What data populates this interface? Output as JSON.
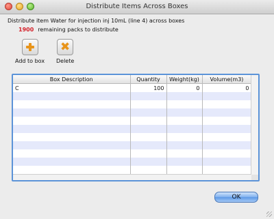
{
  "window": {
    "title": "Distribute Items Across Boxes"
  },
  "info": {
    "description": "Distribute item Water for injection inj 10mL (line 4) across boxes",
    "remaining_count": "1900",
    "remaining_text": "remaining packs to distribute"
  },
  "toolbar": {
    "add_label": "Add to box",
    "delete_label": "Delete",
    "add_icon": "add-box-icon",
    "delete_icon": "delete-icon"
  },
  "table": {
    "columns": [
      "Box Description",
      "Quantity",
      "Weight(kg)",
      "Volume(m3)"
    ],
    "rows": [
      [
        "C",
        "100",
        "0",
        "0"
      ],
      [
        "",
        "",
        "",
        ""
      ],
      [
        "",
        "",
        "",
        ""
      ],
      [
        "",
        "",
        "",
        ""
      ],
      [
        "",
        "",
        "",
        ""
      ],
      [
        "",
        "",
        "",
        ""
      ],
      [
        "",
        "",
        "",
        ""
      ],
      [
        "",
        "",
        "",
        ""
      ],
      [
        "",
        "",
        "",
        ""
      ],
      [
        "",
        "",
        "",
        ""
      ],
      [
        "",
        "",
        "",
        ""
      ]
    ]
  },
  "buttons": {
    "ok_label": "OK"
  },
  "colors": {
    "remaining": "#d4212a",
    "accent": "#5b93d8",
    "stripe": "#e5e9fb",
    "icon": "#e8941a"
  }
}
